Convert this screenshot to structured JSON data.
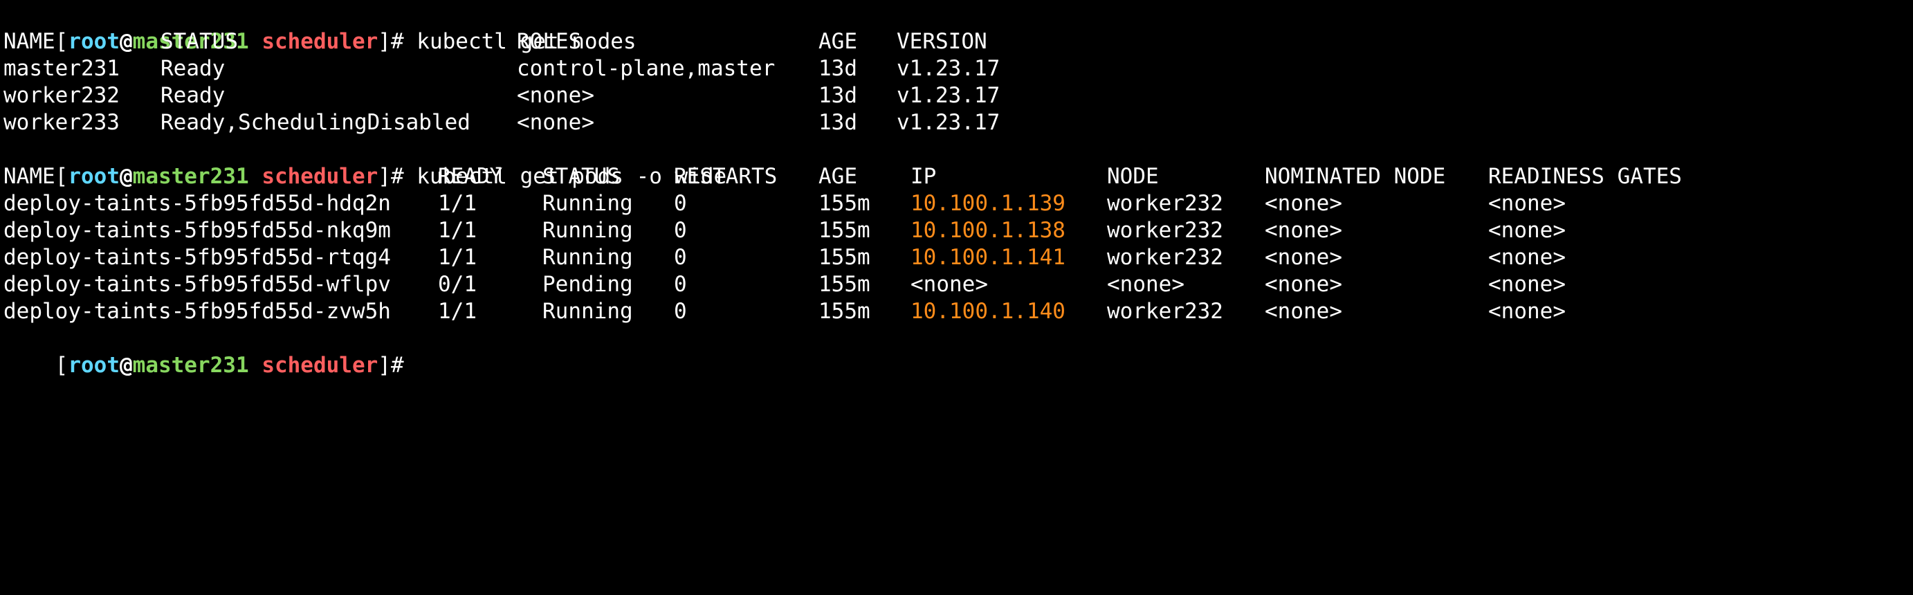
{
  "prompt": {
    "open_bracket": "[",
    "user": "root",
    "at": "@",
    "host": "master231",
    "space": " ",
    "dir": "scheduler",
    "close": "]#"
  },
  "colors": {
    "background": "#000000",
    "text": "#ffffff",
    "user": "#5fd7ff",
    "host": "#87d75f",
    "dir": "#ff5f5f",
    "ip": "#ff8c1a"
  },
  "commands": [
    " kubectl get nodes",
    " kubectl get pods -o wide"
  ],
  "nodes_table": {
    "headers": [
      "NAME",
      "STATUS",
      "ROLES",
      "AGE",
      "VERSION"
    ],
    "rows": [
      [
        "master231",
        "Ready",
        "control-plane,master",
        "13d",
        "v1.23.17"
      ],
      [
        "worker232",
        "Ready",
        "<none>",
        "13d",
        "v1.23.17"
      ],
      [
        "worker233",
        "Ready,SchedulingDisabled",
        "<none>",
        "13d",
        "v1.23.17"
      ]
    ]
  },
  "pods_table": {
    "headers": [
      "NAME",
      "READY",
      "STATUS",
      "RESTARTS",
      "AGE",
      "IP",
      "NODE",
      "NOMINATED NODE",
      "READINESS GATES"
    ],
    "rows": [
      [
        "deploy-taints-5fb95fd55d-hdq2n",
        "1/1",
        "Running",
        "0",
        "155m",
        "10.100.1.139",
        "worker232",
        "<none>",
        "<none>"
      ],
      [
        "deploy-taints-5fb95fd55d-nkq9m",
        "1/1",
        "Running",
        "0",
        "155m",
        "10.100.1.138",
        "worker232",
        "<none>",
        "<none>"
      ],
      [
        "deploy-taints-5fb95fd55d-rtqg4",
        "1/1",
        "Running",
        "0",
        "155m",
        "10.100.1.141",
        "worker232",
        "<none>",
        "<none>"
      ],
      [
        "deploy-taints-5fb95fd55d-wflpv",
        "0/1",
        "Pending",
        "0",
        "155m",
        "<none>",
        "<none>",
        "<none>",
        "<none>"
      ],
      [
        "deploy-taints-5fb95fd55d-zvw5h",
        "1/1",
        "Running",
        "0",
        "155m",
        "10.100.1.140",
        "worker232",
        "<none>",
        "<none>"
      ]
    ]
  }
}
